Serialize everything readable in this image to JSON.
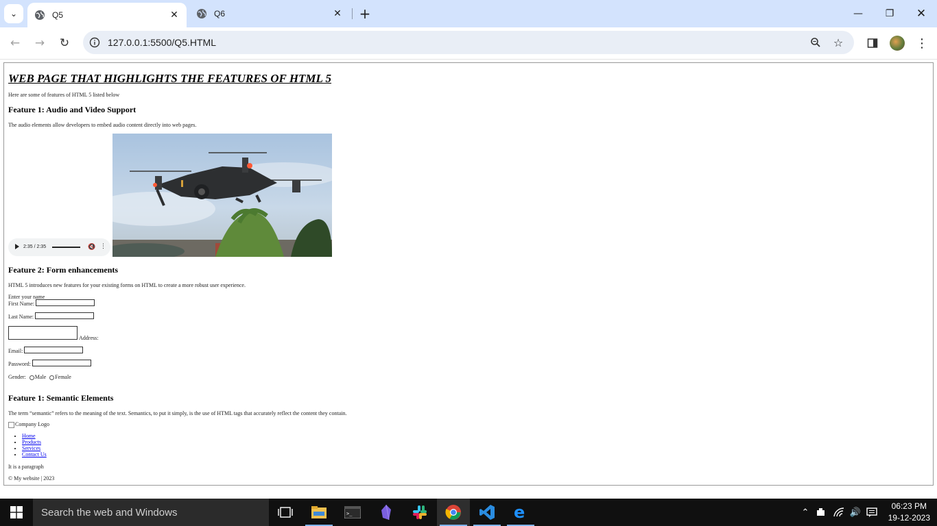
{
  "browser": {
    "tabs": [
      {
        "title": "Q5",
        "active": true
      },
      {
        "title": "Q6",
        "active": false
      }
    ],
    "url": "127.0.0.1:5500/Q5.HTML"
  },
  "page": {
    "title": "WEB PAGE THAT HIGHLIGHTS THE FEATURES OF HTML 5",
    "intro": "Here are some of features of HTML 5 listed below",
    "feature1": {
      "heading": "Feature 1: Audio and Video Support",
      "text": "The audio elements allow developers to embed audio content directly into web pages.",
      "audio_time": "2:35 / 2:35"
    },
    "feature2": {
      "heading": "Feature 2: Form enhancements",
      "text": "HTML 5 introduces new features for your existing forms on HTML to create a more robust user experience.",
      "legend": "Enter your name",
      "first_name_label": "First Name:",
      "last_name_label": "Last Name:",
      "address_label": "Address:",
      "email_label": "Email:",
      "password_label": "Password:",
      "gender_label": "Gender:",
      "gender_male": "Male",
      "gender_female": "Female"
    },
    "feature3": {
      "heading": "Feature 1: Semantic Elements",
      "text": "The term “semantic” refers to the meaning of the text. Semantics, to put it simply, is the use of HTML tags that accurately reflect the content they contain."
    },
    "logo_alt": "Company Logo",
    "nav": [
      "Home",
      "Products",
      "Services",
      "Contact Us"
    ],
    "paragraph": "It is a paragraph",
    "footer": "© My website | 2023"
  },
  "taskbar": {
    "search_placeholder": "Search the web and Windows",
    "time": "06:23 PM",
    "date": "19-12-2023"
  }
}
